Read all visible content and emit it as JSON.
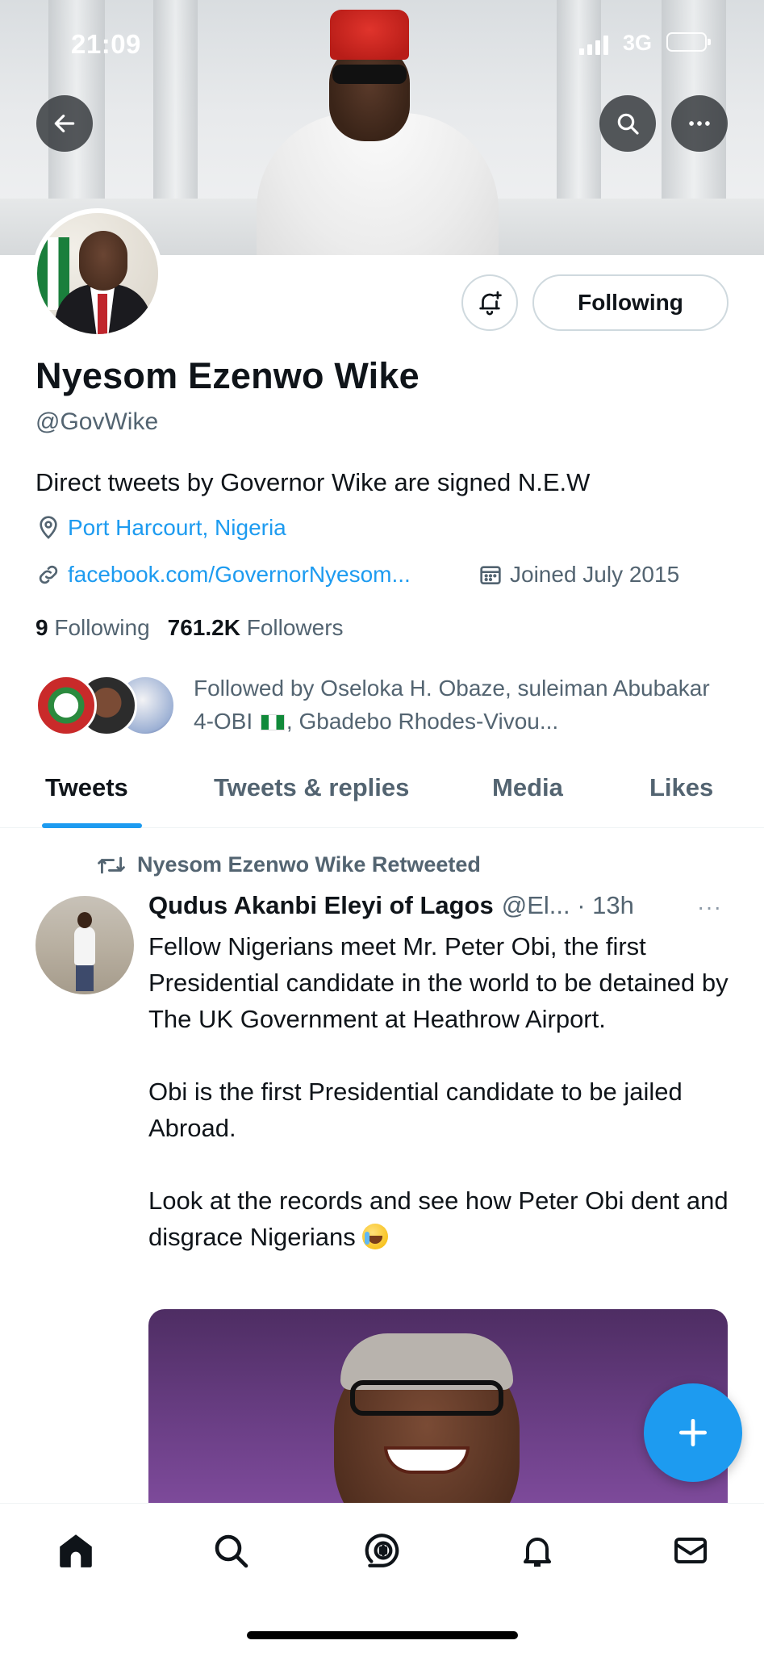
{
  "status_bar": {
    "time": "21:09",
    "network": "3G"
  },
  "profile": {
    "name": "Nyesom Ezenwo Wike",
    "handle": "@GovWike",
    "bio": "Direct tweets by Governor Wike are signed N.E.W",
    "location": "Port Harcourt, Nigeria",
    "website": "facebook.com/GovernorNyesom...",
    "joined": "Joined July 2015",
    "following_count": "9",
    "following_label": "Following",
    "followers_count": "761.2K",
    "followers_label": "Followers",
    "follow_button_label": "Following",
    "followed_by_prefix": "Followed by Oseloka H. Obaze, suleiman Abubakar 4-OBI",
    "followed_by_suffix": ", Gbadebo Rhodes-Vivou..."
  },
  "tabs": [
    {
      "label": "Tweets",
      "active": true
    },
    {
      "label": "Tweets & replies",
      "active": false
    },
    {
      "label": "Media",
      "active": false
    },
    {
      "label": "Likes",
      "active": false
    }
  ],
  "tweet": {
    "retweet_label": "Nyesom Ezenwo Wike Retweeted",
    "author": "Qudus Akanbi Eleyi of Lagos",
    "meta": "@El... · 13h",
    "more": "···",
    "paragraph_1": "Fellow Nigerians meet Mr. Peter Obi, the first Presidential candidate in the world to be detained by The UK Government at Heathrow Airport.",
    "paragraph_2": "Obi is the first Presidential candidate to be jailed Abroad.",
    "paragraph_3": "Look at the records and see how Peter Obi dent and disgrace Nigerians"
  },
  "icons": {
    "back": "arrow-left-icon",
    "search": "search-icon",
    "more": "more-horizontal-icon",
    "notify": "bell-plus-icon",
    "location": "location-pin-icon",
    "link": "link-icon",
    "calendar": "calendar-icon",
    "retweet": "retweet-icon",
    "compose": "plus-icon",
    "nav": [
      "home-icon",
      "search-icon",
      "spaces-icon",
      "notifications-icon",
      "messages-icon"
    ]
  },
  "colors": {
    "accent": "#1d9bf0",
    "text_primary": "#0f1419",
    "text_secondary": "#536471",
    "border": "#cfd9de"
  }
}
